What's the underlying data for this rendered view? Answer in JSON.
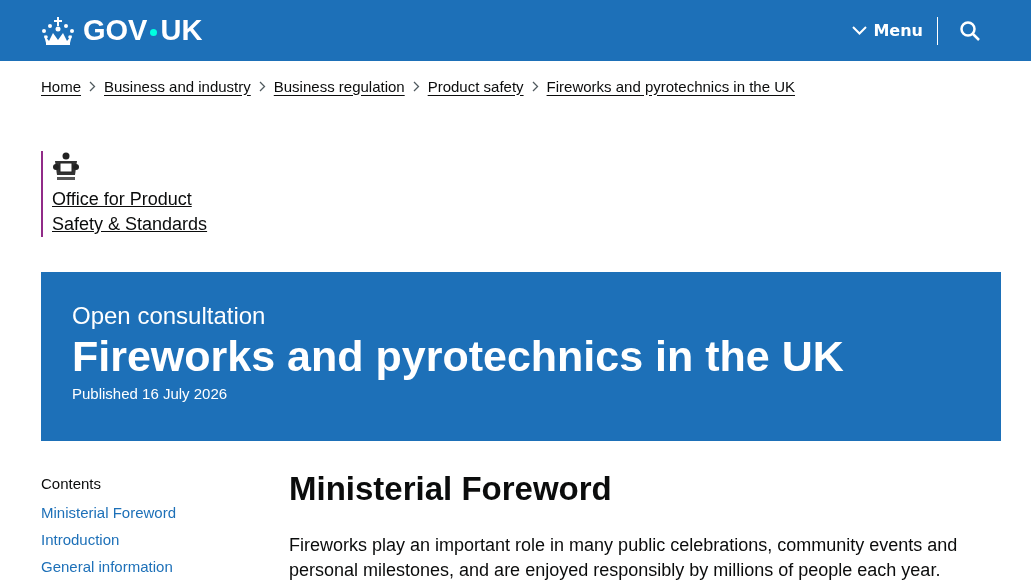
{
  "header": {
    "logo_text": "GOV",
    "logo_text_2": "UK",
    "menu_label": "Menu"
  },
  "breadcrumbs": [
    "Home",
    "Business and industry",
    "Business regulation",
    "Product safety",
    "Fireworks and pyrotechnics in the UK"
  ],
  "organisation": {
    "name": "Office for Product Safety & Standards"
  },
  "banner": {
    "context": "Open consultation",
    "title": "Fireworks and pyrotechnics in the UK",
    "published": "Published 16 July 2026"
  },
  "contents": {
    "heading": "Contents",
    "links": [
      "Ministerial Foreword",
      "Introduction",
      "General information"
    ]
  },
  "main": {
    "heading": "Ministerial Foreword",
    "paragraph": "Fireworks play an important role in many public celebrations, community events and personal milestones, and are enjoyed responsibly by millions of people each year."
  }
}
